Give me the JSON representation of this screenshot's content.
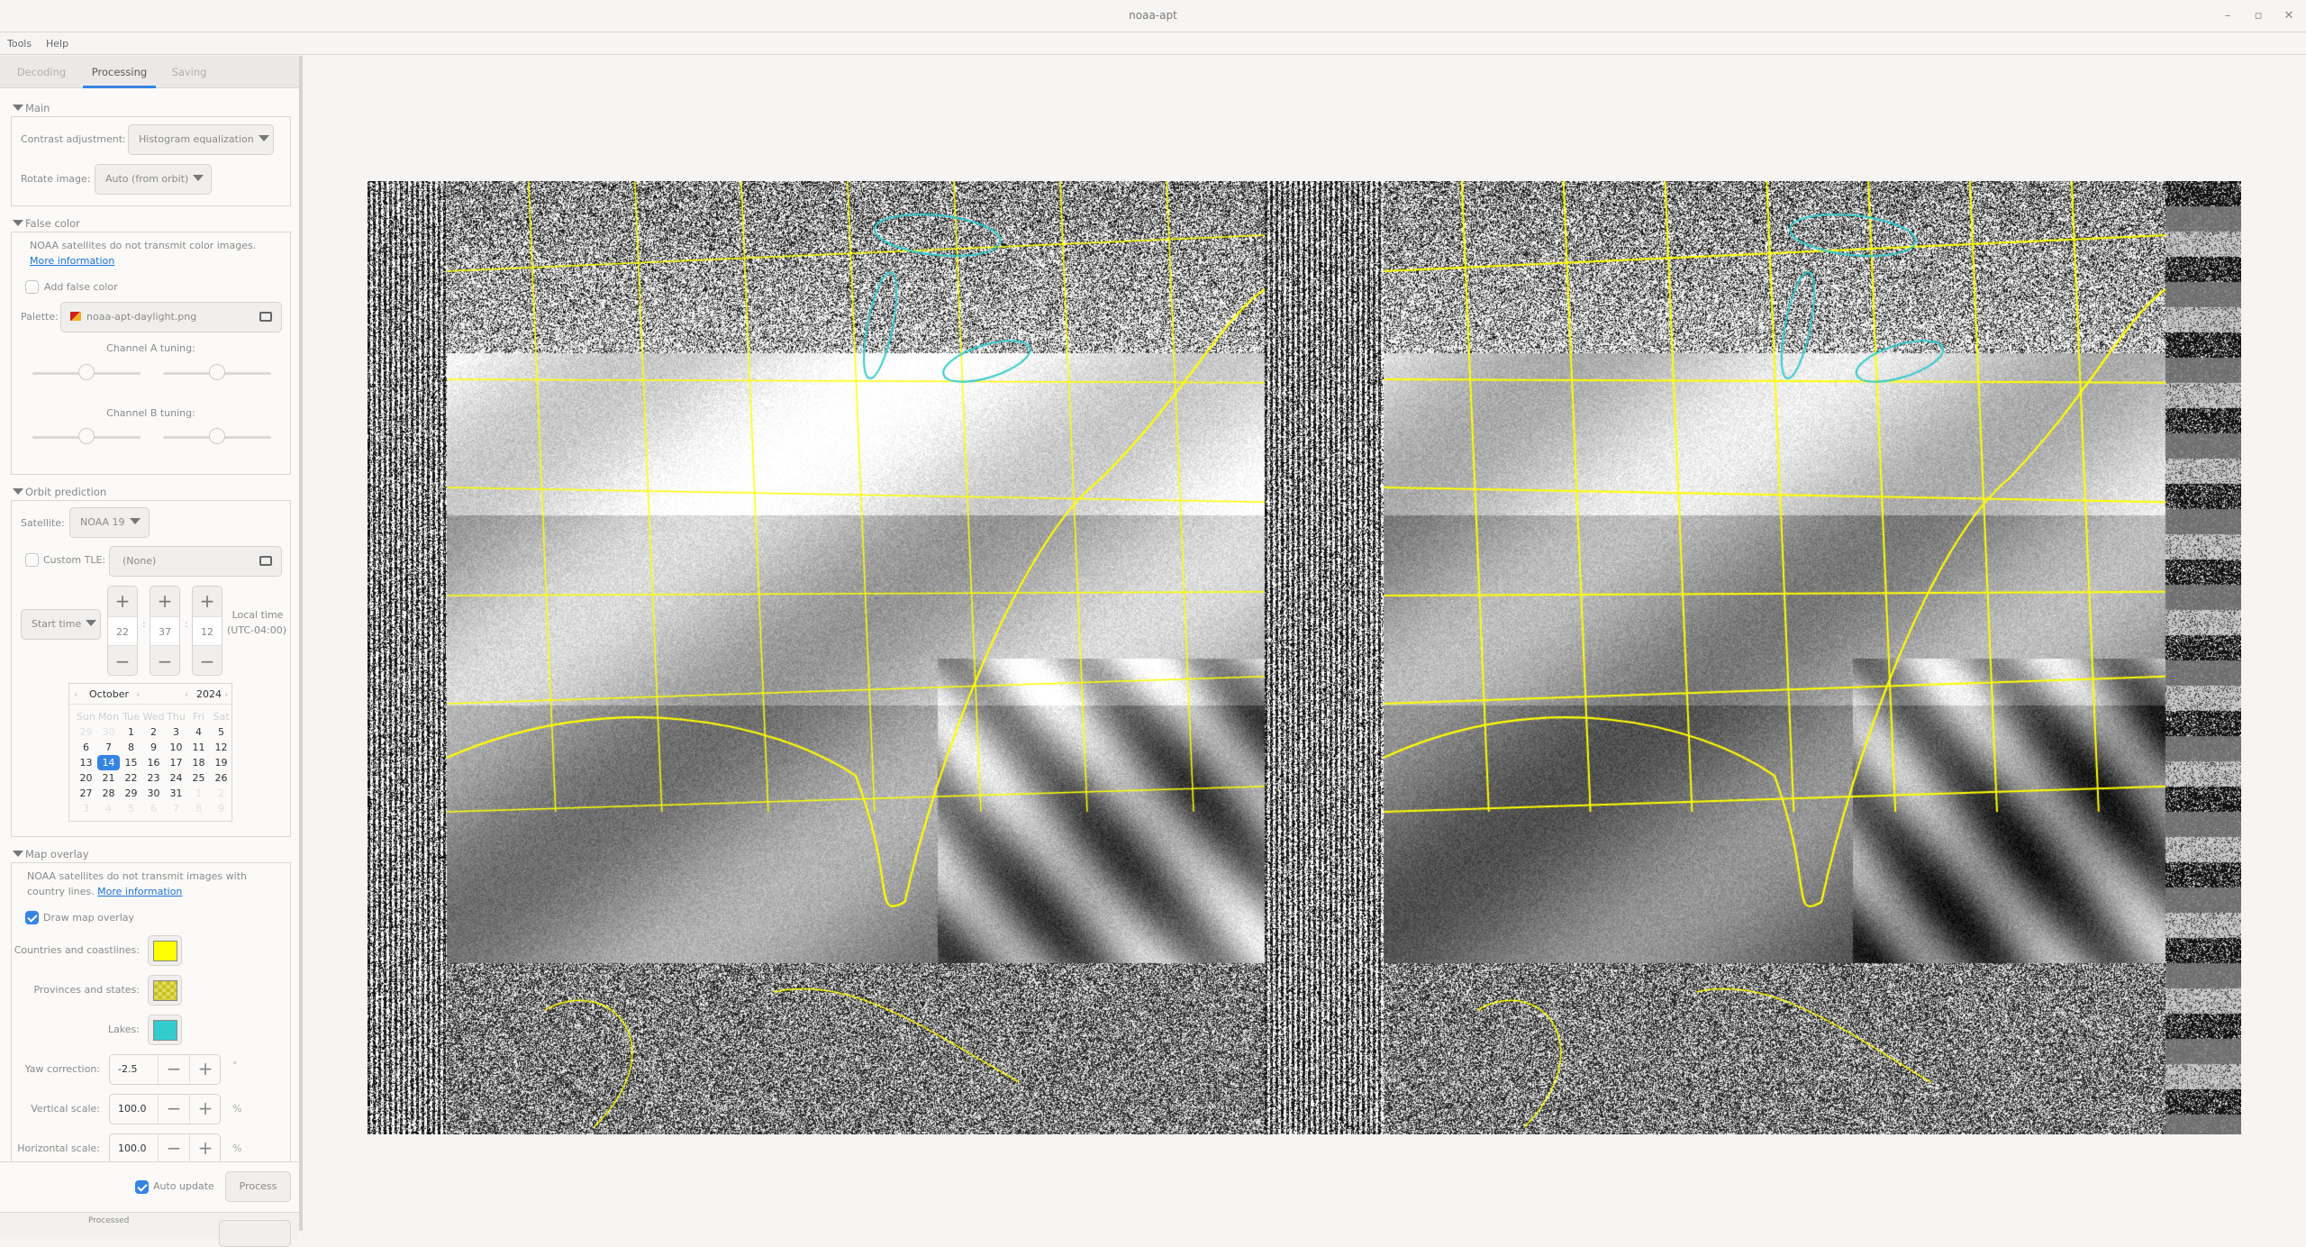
{
  "window": {
    "title": "noaa-apt",
    "controls": {
      "minimize": "–",
      "maximize": "▫",
      "close": "✕"
    }
  },
  "menu": {
    "items": [
      "Tools",
      "Help"
    ]
  },
  "tabs": [
    {
      "label": "Decoding",
      "active": false
    },
    {
      "label": "Processing",
      "active": true
    },
    {
      "label": "Saving",
      "active": false
    }
  ],
  "main": {
    "header": "Main",
    "contrast_label": "Contrast adjustment:",
    "contrast_value": "Histogram equalization",
    "rotate_label": "Rotate image:",
    "rotate_value": "Auto (from orbit)"
  },
  "false_color": {
    "header": "False color",
    "info": "NOAA satellites do not transmit color images.",
    "info_link": "More information",
    "add_label": "Add false color",
    "add_checked": false,
    "palette_label": "Palette:",
    "palette_file": "noaa-apt-daylight.png",
    "channel_a_label": "Channel A tuning:",
    "channel_b_label": "Channel B tuning:",
    "channel_a_values": [
      0.5,
      0.5
    ],
    "channel_b_values": [
      0.5,
      0.5
    ]
  },
  "orbit": {
    "header": "Orbit prediction",
    "satellite_label": "Satellite:",
    "satellite_value": "NOAA 19",
    "custom_tle_label": "Custom TLE:",
    "custom_tle_checked": false,
    "custom_tle_value": "(None)",
    "start_time_label": "Start time",
    "hour": "22",
    "minute": "37",
    "second": "12",
    "separator": ":",
    "local_time_label": "Local time",
    "utc_offset": "(UTC-04:00)",
    "calendar": {
      "month": "October",
      "year": "2024",
      "weekdays": [
        "Sun",
        "Mon",
        "Tue",
        "Wed",
        "Thu",
        "Fri",
        "Sat"
      ],
      "weeks": [
        [
          "29",
          "30",
          "1",
          "2",
          "3",
          "4",
          "5"
        ],
        [
          "6",
          "7",
          "8",
          "9",
          "10",
          "11",
          "12"
        ],
        [
          "13",
          "14",
          "15",
          "16",
          "17",
          "18",
          "19"
        ],
        [
          "20",
          "21",
          "22",
          "23",
          "24",
          "25",
          "26"
        ],
        [
          "27",
          "28",
          "29",
          "30",
          "31",
          "1",
          "2"
        ],
        [
          "3",
          "4",
          "5",
          "6",
          "7",
          "8",
          "9"
        ]
      ],
      "selected_day": "14"
    }
  },
  "map_overlay": {
    "header": "Map overlay",
    "info": "NOAA satellites do not transmit images with country lines.",
    "info_link": "More information",
    "draw_label": "Draw map overlay",
    "draw_checked": true,
    "countries_label": "Countries and coastlines:",
    "countries_color": "#ffff00",
    "provinces_label": "Provinces and states:",
    "provinces_color": "#c8c020",
    "lakes_label": "Lakes:",
    "lakes_color": "#33cccc",
    "yaw_label": "Yaw correction:",
    "yaw_value": "-2.5",
    "yaw_unit": "°",
    "vscale_label": "Vertical scale:",
    "vscale_value": "100.0",
    "vscale_unit": "%",
    "hscale_label": "Horizontal scale:",
    "hscale_value": "100.0",
    "hscale_unit": "%",
    "minus": "−",
    "plus": "+"
  },
  "footer": {
    "auto_update_label": "Auto update",
    "auto_update_checked": true,
    "process_label": "Process",
    "status_label": "Processed"
  },
  "image": {
    "description": "Processed NOAA APT satellite image with map overlay (two channels)"
  }
}
